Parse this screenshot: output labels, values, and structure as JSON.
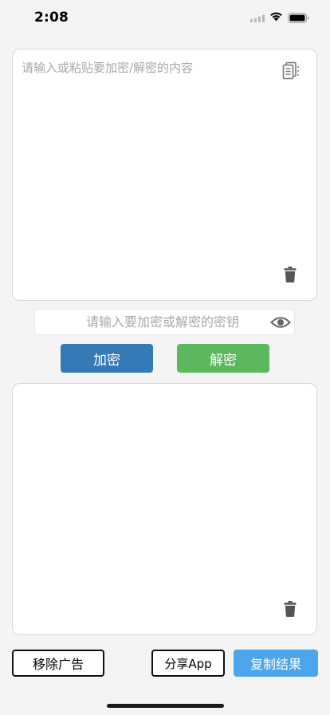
{
  "status_bar": {
    "time": "2:08",
    "icons": [
      "signal-icon",
      "wifi-icon",
      "battery-icon"
    ]
  },
  "input_panel": {
    "placeholder": "请输入或粘贴要加密/解密的内容",
    "value": "",
    "paste_icon": "clipboard-icon",
    "clear_icon": "trash-icon"
  },
  "key_field": {
    "placeholder": "请输入要加密或解密的密钥",
    "value": "",
    "toggle_icon": "eye-icon"
  },
  "actions": {
    "encrypt_label": "加密",
    "decrypt_label": "解密"
  },
  "output_panel": {
    "value": "",
    "clear_icon": "trash-icon"
  },
  "footer": {
    "remove_ads_label": "移除广告",
    "share_label": "分享App",
    "copy_result_label": "复制结果"
  },
  "colors": {
    "encrypt": "#337ab7",
    "decrypt": "#5cb85c",
    "copy": "#4da6ec",
    "background": "#f4f4f4"
  }
}
